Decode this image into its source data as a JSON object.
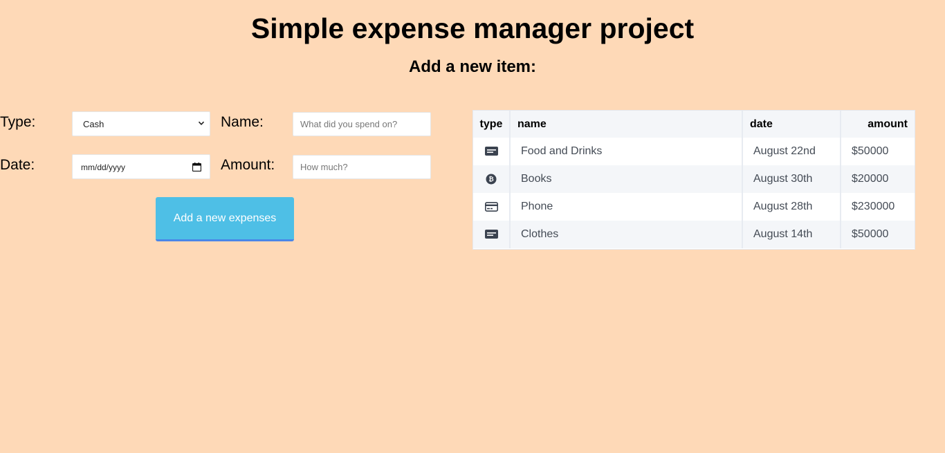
{
  "header": {
    "title": "Simple expense manager project",
    "subtitle": "Add a new item:"
  },
  "form": {
    "type_label": "Type:",
    "type_value": "Cash",
    "name_label": "Name:",
    "name_placeholder": "What did you spend on?",
    "date_label": "Date:",
    "date_placeholder": "mm/dd/yyyy",
    "amount_label": "Amount:",
    "amount_placeholder": "How much?",
    "submit_label": "Add a new expenses"
  },
  "table": {
    "headers": [
      "type",
      "name",
      "date",
      "amount"
    ],
    "rows": [
      {
        "type_icon": "cash-icon",
        "name": "Food and Drinks",
        "date": "August 22nd",
        "amount": "$50000"
      },
      {
        "type_icon": "crypto-icon",
        "name": "Books",
        "date": "August 30th",
        "amount": "$20000"
      },
      {
        "type_icon": "card-icon",
        "name": "Phone",
        "date": "August 28th",
        "amount": "$230000"
      },
      {
        "type_icon": "cash-icon",
        "name": "Clothes",
        "date": "August 14th",
        "amount": "$50000"
      }
    ]
  },
  "colors": {
    "background": "#fed9b7",
    "button": "#4ebfe6",
    "button_border": "#4a86e8",
    "icon": "#3b4350"
  }
}
